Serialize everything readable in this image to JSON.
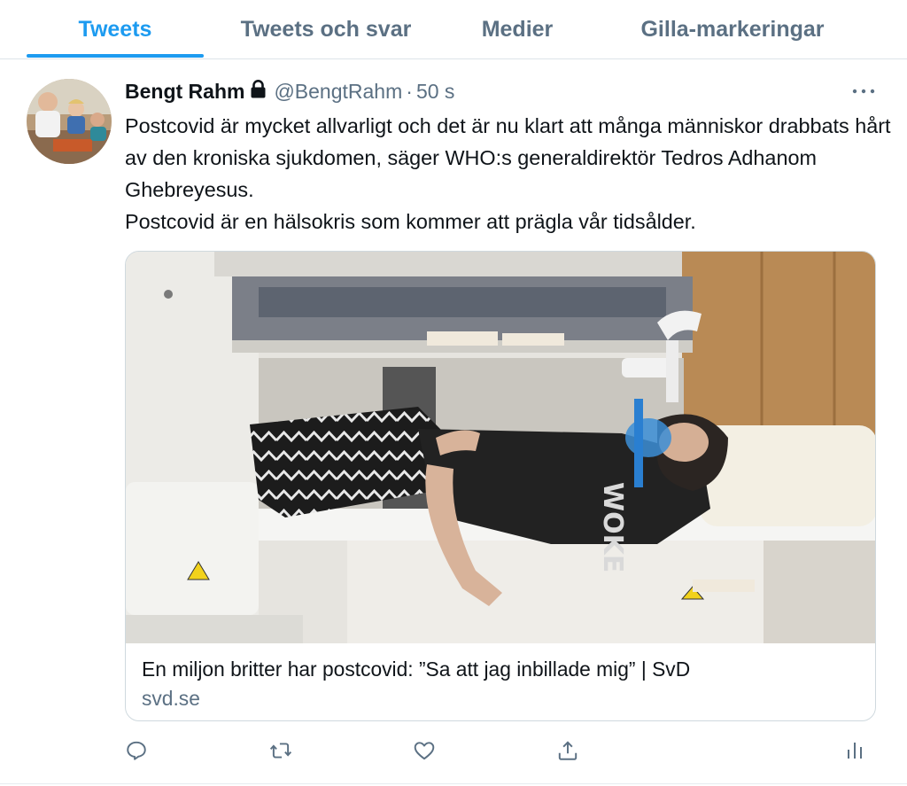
{
  "tabs": [
    {
      "label": "Tweets",
      "active": true
    },
    {
      "label": "Tweets och svar",
      "active": false
    },
    {
      "label": "Medier",
      "active": false
    },
    {
      "label": "Gilla-markeringar",
      "active": false
    }
  ],
  "tweet": {
    "author_name": "Bengt Rahm",
    "author_handle": "@BengtRahm",
    "separator": "·",
    "timestamp": "50 s",
    "text_lines": [
      "Postcovid är mycket allvarligt och det är nu klart att många människor drabbats hårt av den kroniska sjukdomen, säger WHO:s generaldirektör Tedros Adhanom Ghebreyesus.",
      "Postcovid är en hälsokris som kommer att prägla vår tidsålder."
    ],
    "card": {
      "title": "En miljon britter har postcovid: ”Sa att jag inbillade mig” | SvD",
      "domain": "svd.se"
    }
  },
  "icons": {
    "lock": "lock-icon",
    "more": "more-icon",
    "reply": "reply-icon",
    "retweet": "retweet-icon",
    "like": "like-icon",
    "share": "share-icon",
    "analytics": "analytics-icon"
  },
  "colors": {
    "accent": "#1d9bf0",
    "secondary_text": "#5b7083",
    "primary_text": "#0f1419",
    "border": "#cfd9de"
  }
}
